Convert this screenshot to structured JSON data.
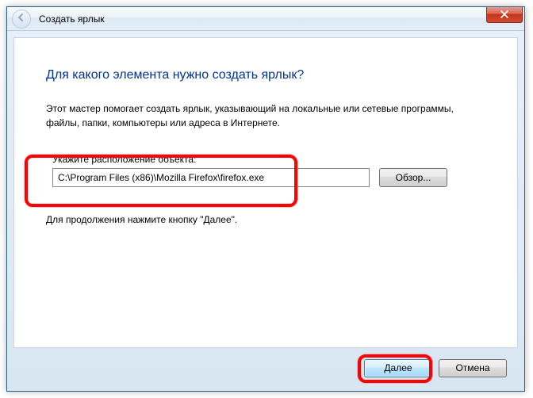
{
  "titlebar": {
    "title": "Создать ярлык"
  },
  "main": {
    "heading": "Для какого элемента нужно создать ярлык?",
    "description": "Этот мастер помогает создать ярлык, указывающий на локальные или сетевые программы, файлы, папки, компьютеры или адреса в Интернете.",
    "field_label": "Укажите расположение объекта:",
    "path_value": "C:\\Program Files (x86)\\Mozilla Firefox\\firefox.exe",
    "browse_label": "Обзор...",
    "continue_hint": "Для продолжения нажмите кнопку \"Далее\"."
  },
  "footer": {
    "next_label": "Далее",
    "cancel_label": "Отмена"
  },
  "icons": {
    "back": "back-arrow-icon",
    "close": "close-icon"
  }
}
